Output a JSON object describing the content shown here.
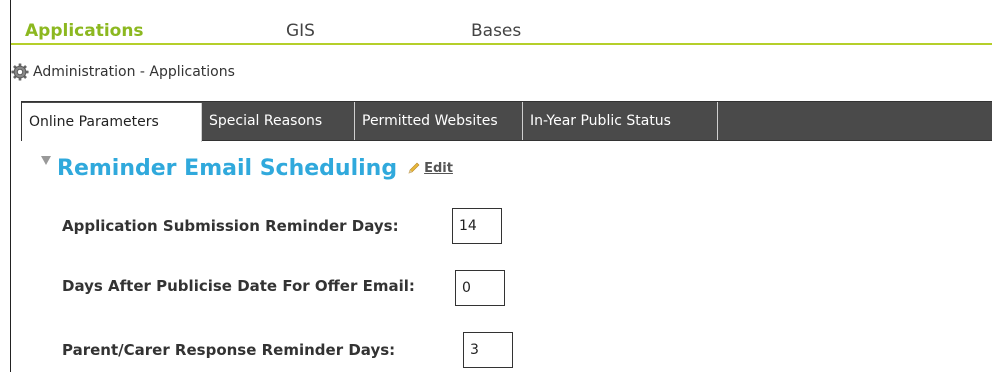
{
  "nav": {
    "items": [
      {
        "label": "Applications",
        "active": true
      },
      {
        "label": "GIS",
        "active": false
      },
      {
        "label": "Bases",
        "active": false
      }
    ]
  },
  "breadcrumb": {
    "icon": "gear-icon",
    "text": "Administration - Applications"
  },
  "tabs": [
    {
      "label": "Online Parameters",
      "active": true
    },
    {
      "label": "Special Reasons",
      "active": false
    },
    {
      "label": "Permitted Websites",
      "active": false
    },
    {
      "label": "In-Year Public Status",
      "active": false
    }
  ],
  "section": {
    "title": "Reminder Email Scheduling",
    "edit_label": "Edit",
    "title_color": "#30a9dc"
  },
  "fields": [
    {
      "label": "Application Submission Reminder Days:",
      "value": "14"
    },
    {
      "label": "Days After Publicise Date For Offer Email:",
      "value": "0"
    },
    {
      "label": "Parent/Carer Response Reminder Days:",
      "value": "3"
    }
  ],
  "colors": {
    "accent": "#8cb820",
    "tabbar": "#4a4a4a"
  }
}
